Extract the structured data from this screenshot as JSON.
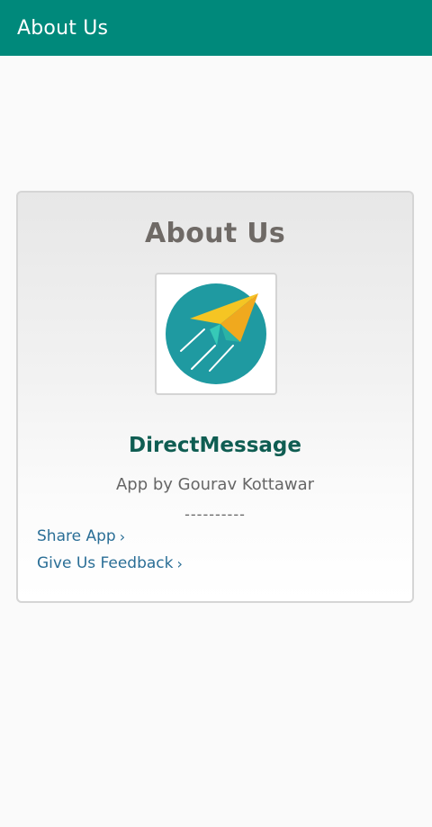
{
  "appbar": {
    "title": "About Us",
    "color": "#00897b"
  },
  "card": {
    "title": "About Us",
    "logo_icon": "paper-plane-icon",
    "app_name": "DirectMessage",
    "author": "App by Gourav Kottawar",
    "divider": "----------",
    "links": [
      {
        "label": "Share App",
        "icon": "chevron-right-icon"
      },
      {
        "label": "Give Us Feedback",
        "icon": "chevron-right-icon"
      }
    ]
  }
}
